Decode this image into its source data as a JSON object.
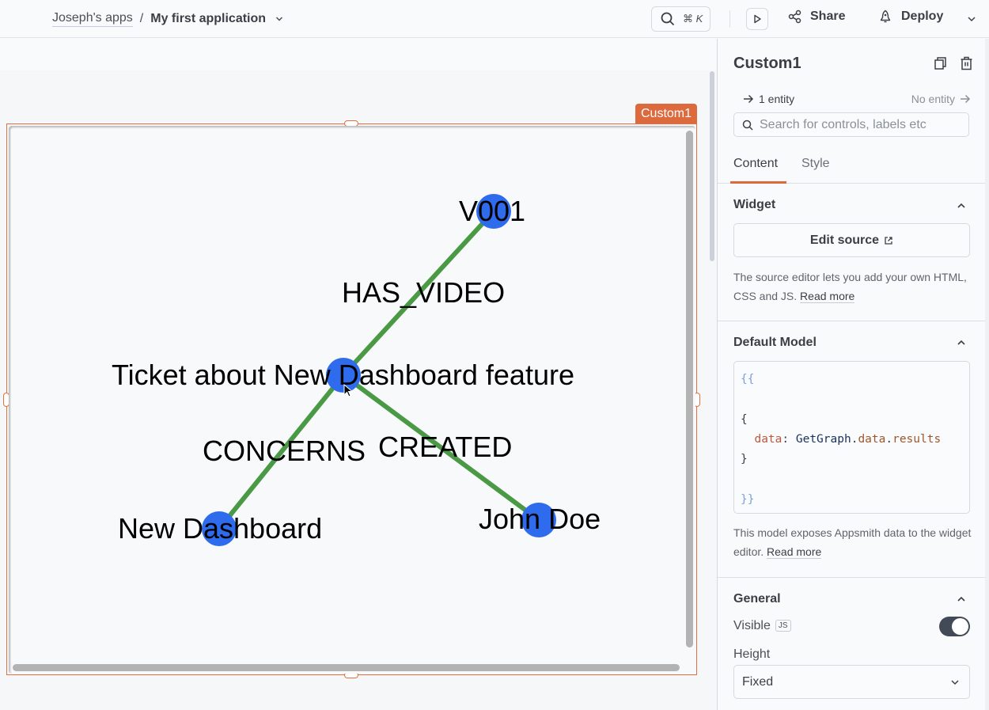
{
  "header": {
    "breadcrumb_parent": "Joseph's apps",
    "breadcrumb_separator": "/",
    "app_name": "My first application",
    "search_shortcut": "⌘ K",
    "share_label": "Share",
    "deploy_label": "Deploy"
  },
  "canvas": {
    "widget_name": "Custom1",
    "graph": {
      "node_color": "#2f6bed",
      "edge_color": "#4a9a45",
      "nodes": [
        {
          "id": "V001",
          "label": "V001"
        },
        {
          "id": "ticket",
          "label": "Ticket about New Dashboard feature"
        },
        {
          "id": "dashboard",
          "label": "New Dashboard"
        },
        {
          "id": "john",
          "label": "John Doe"
        }
      ],
      "edges": [
        {
          "from": "ticket",
          "to": "V001",
          "label": "HAS_VIDEO"
        },
        {
          "from": "ticket",
          "to": "dashboard",
          "label": "CONCERNS"
        },
        {
          "from": "ticket",
          "to": "john",
          "label": "CREATED"
        }
      ]
    }
  },
  "panel": {
    "title": "Custom1",
    "entity_in": "1 entity",
    "entity_out": "No entity",
    "search_placeholder": "Search for controls, labels etc",
    "tabs": [
      {
        "label": "Content",
        "active": true
      },
      {
        "label": "Style",
        "active": false
      }
    ],
    "widget_section": {
      "title": "Widget",
      "edit_source_label": "Edit source",
      "help_text": "The source editor lets you add your own HTML, CSS and JS.",
      "read_more": "Read more"
    },
    "default_model_section": {
      "title": "Default Model",
      "code": {
        "open": "{{",
        "obj_open": "{",
        "key": "data",
        "colon": ": ",
        "object": "GetGraph",
        "dot1": ".",
        "prop1": "data",
        "dot2": ".",
        "prop2": "results",
        "obj_close": "}",
        "close": "}}"
      },
      "help_text": "This model exposes Appsmith data to the widget editor.",
      "read_more": "Read more"
    },
    "general_section": {
      "title": "General",
      "visible_label": "Visible",
      "js_badge": "JS",
      "visible_on": true,
      "height_label": "Height",
      "height_value": "Fixed"
    }
  }
}
